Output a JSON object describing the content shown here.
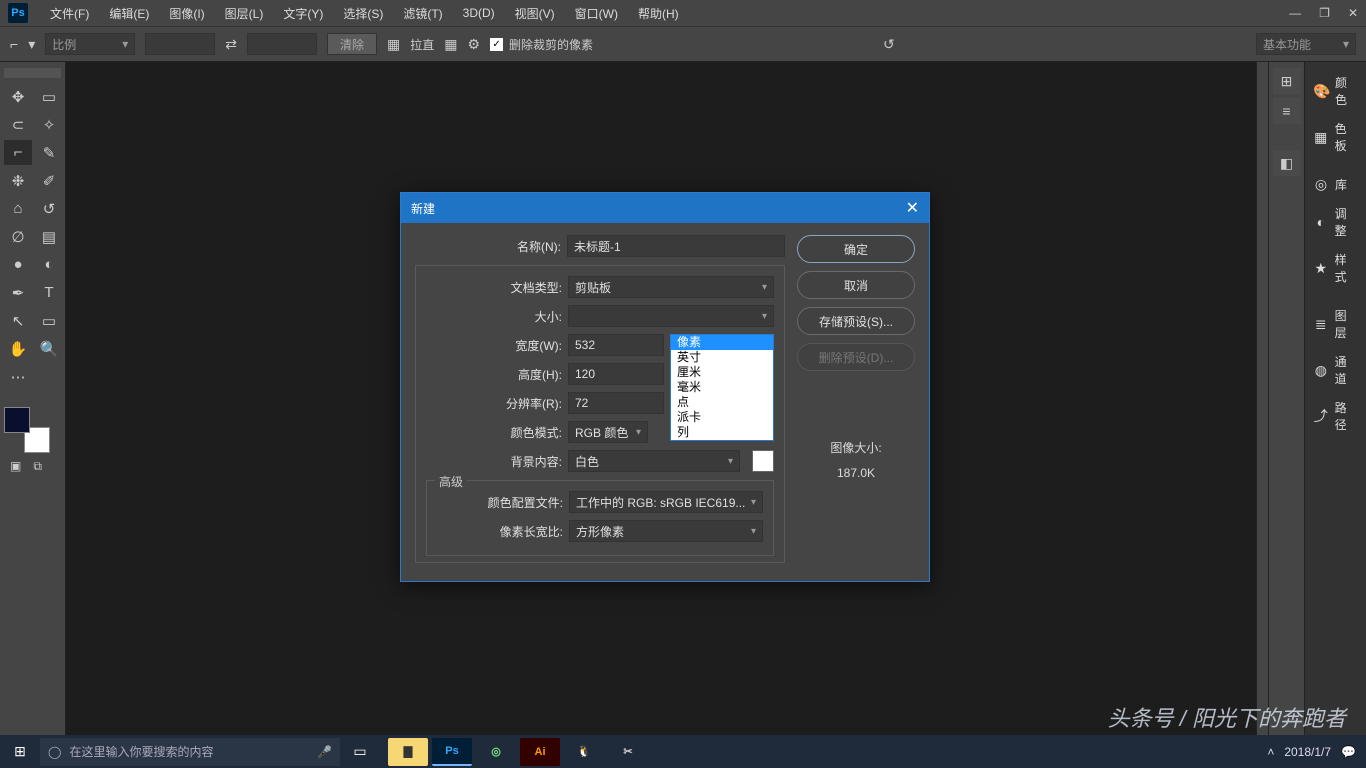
{
  "menubar": {
    "items": [
      "文件(F)",
      "编辑(E)",
      "图像(I)",
      "图层(L)",
      "文字(Y)",
      "选择(S)",
      "滤镜(T)",
      "3D(D)",
      "视图(V)",
      "窗口(W)",
      "帮助(H)"
    ]
  },
  "optionsbar": {
    "ratio": "比例",
    "clear": "清除",
    "straighten": "拉直",
    "delete_crop": "删除裁剪的像素",
    "workspace": "基本功能"
  },
  "right_panels": {
    "items": [
      "颜色",
      "色板",
      "库",
      "调整",
      "样式",
      "图层",
      "通道",
      "路径"
    ]
  },
  "dialog": {
    "title": "新建",
    "labels": {
      "name": "名称(N):",
      "doc_type": "文档类型:",
      "size": "大小:",
      "width": "宽度(W):",
      "height": "高度(H):",
      "resolution": "分辨率(R):",
      "color_mode": "颜色模式:",
      "bg": "背景内容:",
      "advanced": "高级",
      "profile": "颜色配置文件:",
      "aspect": "像素长宽比:",
      "img_size_label": "图像大小:"
    },
    "values": {
      "name": "未标题-1",
      "doc_type": "剪贴板",
      "size": "",
      "width": "532",
      "width_unit": "像素",
      "height": "120",
      "resolution": "72",
      "color_mode": "RGB 颜色",
      "bg": "白色",
      "profile": "工作中的 RGB: sRGB IEC619...",
      "aspect": "方形像素",
      "img_size": "187.0K"
    },
    "buttons": {
      "ok": "确定",
      "cancel": "取消",
      "save_preset": "存储预设(S)...",
      "delete_preset": "删除预设(D)..."
    },
    "unit_options": [
      "像素",
      "英寸",
      "厘米",
      "毫米",
      "点",
      "派卡",
      "列"
    ]
  },
  "taskbar": {
    "search_placeholder": "在这里输入你要搜索的内容",
    "time": "2018/1/7"
  },
  "watermark": "头条号 / 阳光下的奔跑者"
}
